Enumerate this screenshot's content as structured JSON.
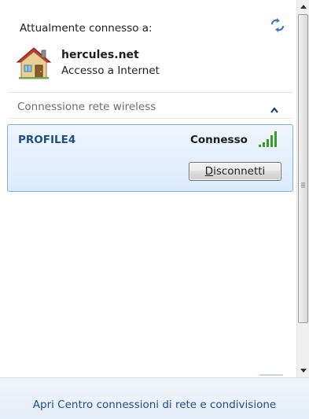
{
  "current_connection": {
    "header": "Attualmente connesso a:",
    "network_name": "hercules.net",
    "network_status": "Accesso a Internet",
    "icons": {
      "refresh": "refresh-icon",
      "network": "house-icon"
    }
  },
  "wireless_section": {
    "label": "Connessione rete wireless",
    "toggle_icon": "chevron-up-icon",
    "networks": [
      {
        "name": "PROFILE4",
        "status": "Connesso",
        "signal_icon": "signal-strength-icon",
        "button": {
          "mnemonic": "D",
          "rest": "isconnetti"
        }
      }
    ]
  },
  "footer": {
    "link": "Apri Centro connessioni di rete e condivisione"
  },
  "colors": {
    "link_blue": "#1e4e8c",
    "selected_border": "#84acdd",
    "selected_bg": "#dcebfc",
    "signal_green": "#3a9d23"
  }
}
